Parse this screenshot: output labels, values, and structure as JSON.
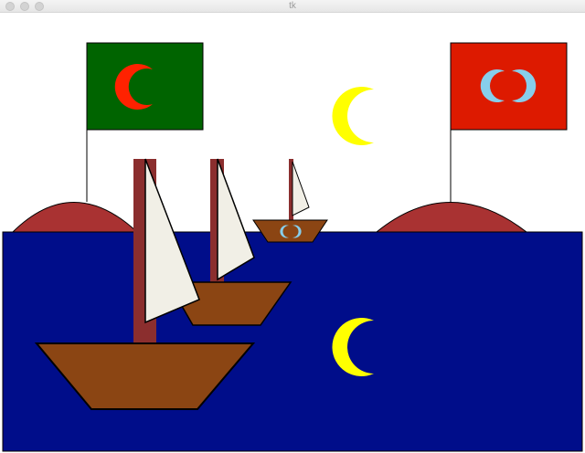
{
  "window": {
    "title": "tk",
    "controls": [
      "close-button",
      "minimize-button",
      "zoom-button"
    ]
  },
  "scene": {
    "colors": {
      "sky": "#ffffff",
      "sea": "#000d8a",
      "island": "#a93232",
      "mast": "#8b2e2e",
      "hull": "#8b4513",
      "sail": "#f1efe6",
      "moon": "#ffff00",
      "hull_emblem": "#87ceeb",
      "flag_green": "#006400",
      "flag_green_crescent": "#ff2200",
      "flag_red": "#dd1a00",
      "flag_red_emblem": "#87ceeb"
    },
    "objects": [
      "left-island",
      "right-island",
      "sea",
      "left-flag",
      "right-flag",
      "sky-moon",
      "sea-moon-reflection",
      "large-boat",
      "medium-boat",
      "small-boat"
    ]
  }
}
